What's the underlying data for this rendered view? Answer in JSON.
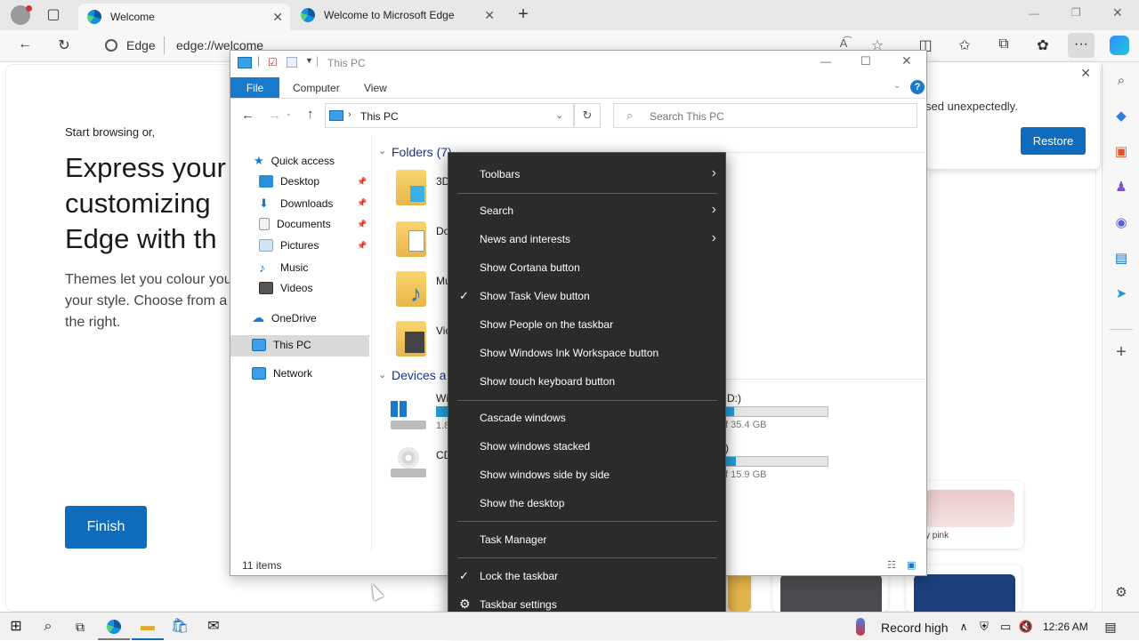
{
  "edge": {
    "tabs": [
      {
        "label": "Welcome"
      },
      {
        "label": "Welcome to Microsoft Edge"
      }
    ],
    "address": {
      "site_label": "Edge",
      "url": "edge://welcome"
    },
    "welcome": {
      "start": "Start browsing or,",
      "heading_lines": [
        "Express your",
        "customizing",
        "Edge with th"
      ],
      "body_lines": [
        "Themes let you colour you",
        "your style. Choose from a",
        "the right."
      ],
      "finish_label": "Finish"
    },
    "restore": {
      "message": "sed unexpectedly.",
      "button_label": "Restore"
    },
    "theme_cards": [
      {
        "label": "y pink"
      }
    ]
  },
  "explorer": {
    "title": "This PC",
    "ribbon_tabs": [
      "File",
      "Computer",
      "View"
    ],
    "breadcrumb": "This PC",
    "search_placeholder": "Search This PC",
    "nav": {
      "quick_access": "Quick access",
      "items": [
        "Desktop",
        "Downloads",
        "Documents",
        "Pictures",
        "Music",
        "Videos"
      ],
      "onedrive": "OneDrive",
      "this_pc": "This PC",
      "network": "Network"
    },
    "folders_header": "Folders (7)",
    "folders": [
      "3D",
      "Do",
      "Mu",
      "Vic"
    ],
    "devices_header": "Devices a",
    "devices": [
      {
        "name": "Wi",
        "size": "1.8"
      },
      {
        "name": "CD",
        "size": ""
      }
    ],
    "right_drives": [
      {
        "name": "D:)",
        "size": "f 35.4 GB",
        "used": 0.08
      },
      {
        "name": ")",
        "size": "f 15.9 GB",
        "used": 0.1
      }
    ],
    "status": "11 items"
  },
  "context_menu": {
    "groups": [
      [
        {
          "label": "Toolbars",
          "submenu": true,
          "checked": false
        }
      ],
      [
        {
          "label": "Search",
          "submenu": true,
          "checked": false
        },
        {
          "label": "News and interests",
          "submenu": true,
          "checked": false
        },
        {
          "label": "Show Cortana button",
          "submenu": false,
          "checked": false
        },
        {
          "label": "Show Task View button",
          "submenu": false,
          "checked": true
        },
        {
          "label": "Show People on the taskbar",
          "submenu": false,
          "checked": false
        },
        {
          "label": "Show Windows Ink Workspace button",
          "submenu": false,
          "checked": false
        },
        {
          "label": "Show touch keyboard button",
          "submenu": false,
          "checked": false
        }
      ],
      [
        {
          "label": "Cascade windows",
          "submenu": false,
          "checked": false
        },
        {
          "label": "Show windows stacked",
          "submenu": false,
          "checked": false
        },
        {
          "label": "Show windows side by side",
          "submenu": false,
          "checked": false
        },
        {
          "label": "Show the desktop",
          "submenu": false,
          "checked": false
        }
      ],
      [
        {
          "label": "Task Manager",
          "submenu": false,
          "checked": false
        }
      ],
      [
        {
          "label": "Lock the taskbar",
          "submenu": false,
          "checked": true
        },
        {
          "label": "Taskbar settings",
          "submenu": false,
          "checked": false,
          "gear": true
        }
      ]
    ]
  },
  "taskbar": {
    "weather": "Record high",
    "clock": "12:26 AM"
  },
  "colors": {
    "accent": "#0f6cbd",
    "file_tab": "#1979ca",
    "menu_bg": "#2b2b2b"
  }
}
